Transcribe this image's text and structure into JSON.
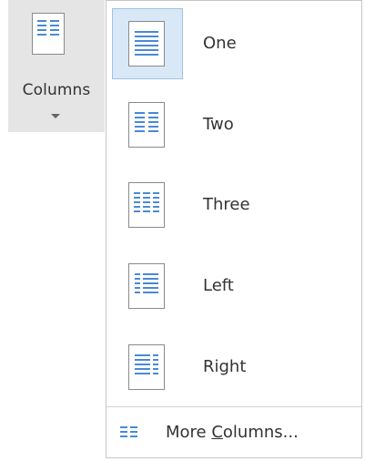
{
  "ribbon": {
    "button_label": "Columns"
  },
  "menu": {
    "items": [
      {
        "label": "One",
        "icon": "one-column-icon",
        "selected": true
      },
      {
        "label": "Two",
        "icon": "two-columns-icon",
        "selected": false
      },
      {
        "label": "Three",
        "icon": "three-columns-icon",
        "selected": false
      },
      {
        "label": "Left",
        "icon": "left-column-icon",
        "selected": false
      },
      {
        "label": "Right",
        "icon": "right-column-icon",
        "selected": false
      }
    ],
    "more": {
      "label_pre": "More ",
      "label_accel": "C",
      "label_post": "olumns..."
    }
  },
  "colors": {
    "accent": "#4a89d6",
    "selected_bg": "#d9e8f6",
    "selected_border": "#9cc3e5"
  }
}
